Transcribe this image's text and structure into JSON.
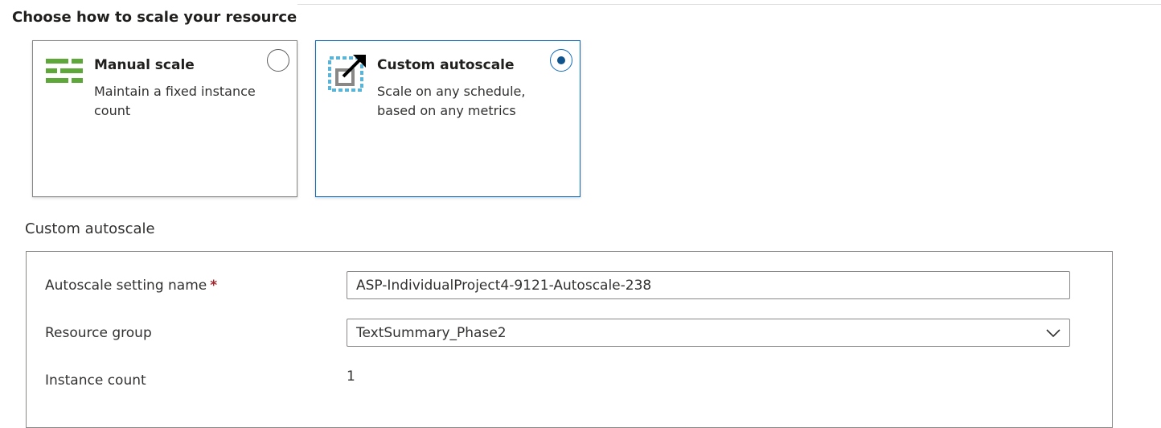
{
  "header": {
    "title": "Choose how to scale your resource"
  },
  "scale_options": [
    {
      "title": "Manual scale",
      "description": "Maintain a fixed instance count",
      "icon": "manual-scale-icon",
      "selected": false
    },
    {
      "title": "Custom autoscale",
      "description": "Scale on any schedule, based on any metrics",
      "icon": "custom-autoscale-icon",
      "selected": true
    }
  ],
  "custom_autoscale": {
    "section_title": "Custom autoscale",
    "setting_name_label": "Autoscale setting name",
    "required_marker": "*",
    "setting_name_value": "ASP-IndividualProject4-9121-Autoscale-238",
    "resource_group_label": "Resource group",
    "resource_group_value": "TextSummary_Phase2",
    "instance_count_label": "Instance count",
    "instance_count_value": "1"
  },
  "colors": {
    "accent": "#0f6cbd",
    "radio_dot": "#0f548c",
    "manual_icon_green": "#5ea83a",
    "autoscale_icon_blue": "#59b4d9",
    "required": "#a4262c"
  }
}
